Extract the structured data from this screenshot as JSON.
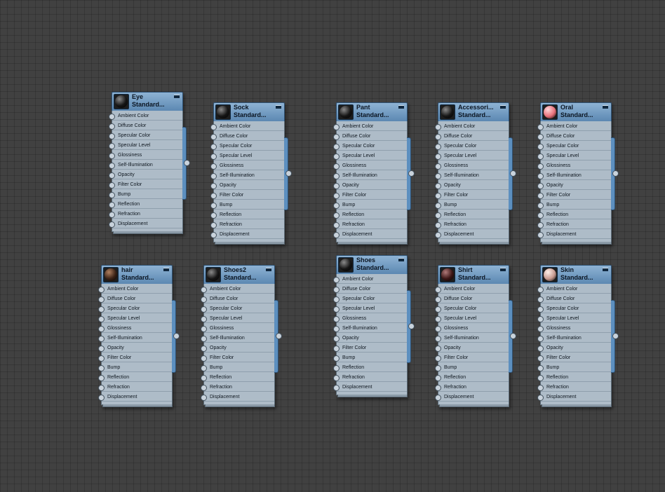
{
  "slot_labels": [
    "Ambient Color",
    "Diffuse Color",
    "Specular Color",
    "Specular Level",
    "Glossiness",
    "Self-Illumination",
    "Opacity",
    "Filter Color",
    "Bump",
    "Reflection",
    "Refraction",
    "Displacement"
  ],
  "nodes": [
    {
      "id": "eye",
      "name": "Eye",
      "type": "Standard...",
      "sphere_color": "#151515",
      "highlight": "#8a8a8a"
    },
    {
      "id": "sock",
      "name": "Sock",
      "type": "Standard...",
      "sphere_color": "#151515",
      "highlight": "#8a8a8a"
    },
    {
      "id": "pant",
      "name": "Pant",
      "type": "Standard...",
      "sphere_color": "#151515",
      "highlight": "#8a8a8a"
    },
    {
      "id": "accessori",
      "name": "Accessori...",
      "type": "Standard...",
      "sphere_color": "#151515",
      "highlight": "#8a8a8a"
    },
    {
      "id": "oral",
      "name": "Oral",
      "type": "Standard...",
      "sphere_color": "#e7707a",
      "highlight": "#ffd6da"
    },
    {
      "id": "hair",
      "name": "hair",
      "type": "Standard...",
      "sphere_color": "#3a2216",
      "highlight": "#b08060"
    },
    {
      "id": "shoes2",
      "name": "Shoes2",
      "type": "Standard...",
      "sphere_color": "#151515",
      "highlight": "#8a8a8a"
    },
    {
      "id": "shoes",
      "name": "Shoes",
      "type": "Standard...",
      "sphere_color": "#151515",
      "highlight": "#8a8a8a"
    },
    {
      "id": "shirt",
      "name": "Shirt",
      "type": "Standard...",
      "sphere_color": "#3c1616",
      "highlight": "#b07a7a"
    },
    {
      "id": "skin",
      "name": "Skin",
      "type": "Standard...",
      "sphere_color": "#c79a90",
      "highlight": "#fff0ea"
    }
  ]
}
